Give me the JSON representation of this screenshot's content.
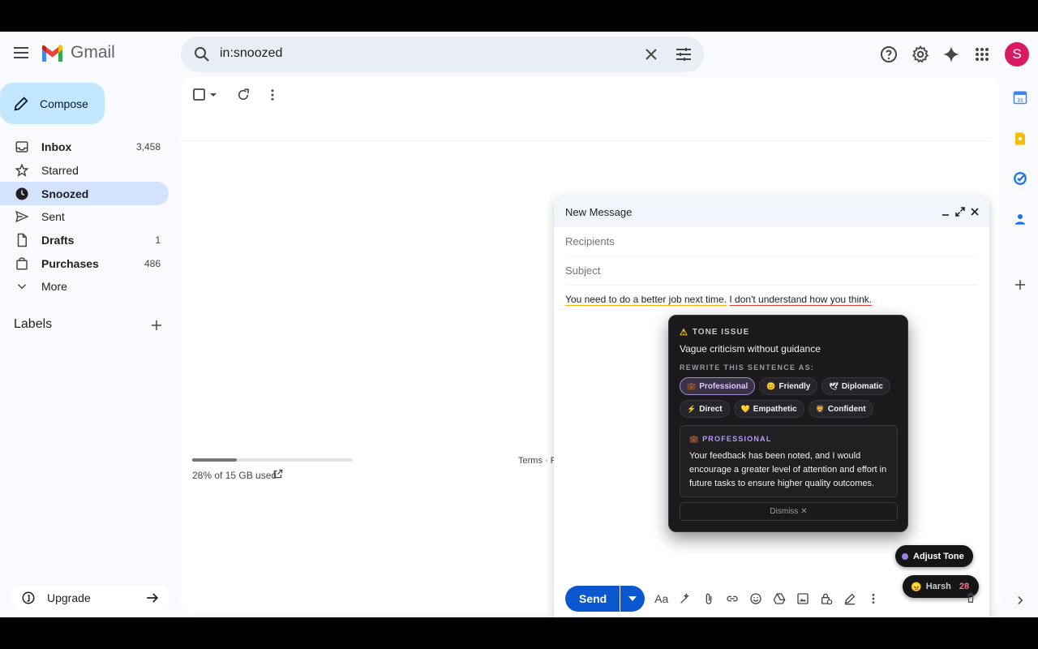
{
  "app": {
    "name": "Gmail"
  },
  "search": {
    "query": "in:snoozed"
  },
  "account": {
    "avatar_letter": "S",
    "avatar_color": "#d81b60"
  },
  "compose_label": "Compose",
  "nav": [
    {
      "label": "Inbox",
      "count": "3,458",
      "icon": "inbox-icon",
      "bold": true,
      "active": false
    },
    {
      "label": "Starred",
      "count": "",
      "icon": "star-icon",
      "bold": false,
      "active": false
    },
    {
      "label": "Snoozed",
      "count": "",
      "icon": "clock-icon",
      "bold": true,
      "active": true
    },
    {
      "label": "Sent",
      "count": "",
      "icon": "send-icon",
      "bold": false,
      "active": false
    },
    {
      "label": "Drafts",
      "count": "1",
      "icon": "draft-icon",
      "bold": true,
      "active": false
    },
    {
      "label": "Purchases",
      "count": "486",
      "icon": "shopping-bag-icon",
      "bold": true,
      "active": false
    },
    {
      "label": "More",
      "count": "",
      "icon": "chevron-down-icon",
      "bold": false,
      "active": false
    }
  ],
  "labels_heading": "Labels",
  "upgrade_label": "Upgrade",
  "storage": {
    "text": "28% of 15 GB used",
    "fraction": 0.28
  },
  "footer": {
    "terms": "Terms · P"
  },
  "composer": {
    "title": "New Message",
    "recipients_placeholder": "Recipients",
    "subject_placeholder": "Subject",
    "sentence_1": "You need to do a better job next time.",
    "sentence_2": "I don't understand how you think.",
    "send_label": "Send"
  },
  "tone_popup": {
    "heading": "TONE ISSUE",
    "issue": "Vague criticism without guidance",
    "rewrite_label": "REWRITE THIS SENTENCE AS:",
    "options": [
      {
        "emoji": "💼",
        "label": "Professional",
        "selected": true
      },
      {
        "emoji": "😊",
        "label": "Friendly",
        "selected": false
      },
      {
        "emoji": "🕊",
        "label": "Diplomatic",
        "selected": false
      },
      {
        "emoji": "⚡",
        "label": "Direct",
        "selected": false
      },
      {
        "emoji": "💛",
        "label": "Empathetic",
        "selected": false
      },
      {
        "emoji": "🦁",
        "label": "Confident",
        "selected": false
      }
    ],
    "suggestion_heading": "PROFESSIONAL",
    "suggestion_emoji": "💼",
    "suggestion_text": "Your feedback has been noted, and I would encourage a greater level of attention and effort in future tasks to ensure higher quality outcomes.",
    "dismiss_label": "Dismiss ✕"
  },
  "adjust_tone_label": "Adjust Tone",
  "harsh_badge": {
    "emoji": "😠",
    "label": "Harsh",
    "count": "28"
  }
}
